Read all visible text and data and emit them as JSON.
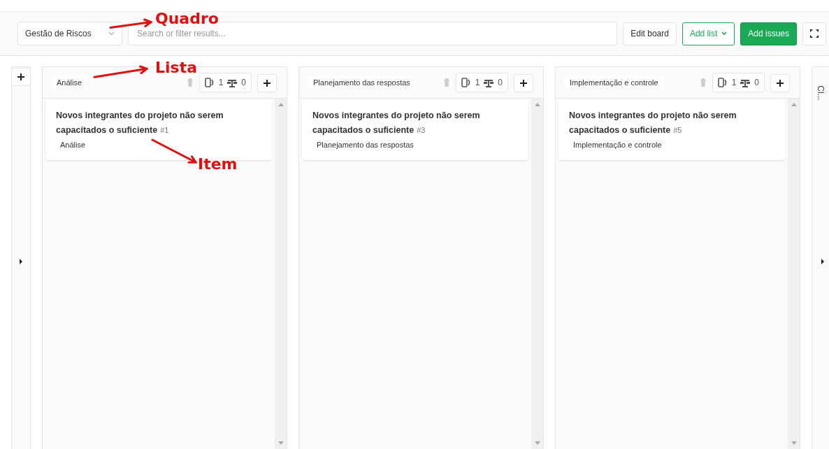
{
  "board_selector": {
    "value": "Gestão de Riscos"
  },
  "search": {
    "placeholder": "Search or filter results..."
  },
  "toolbar_buttons": [
    {
      "kind": "default",
      "label": "Edit board"
    },
    {
      "kind": "outline",
      "label": "Add list"
    },
    {
      "kind": "primary",
      "label": "Add issues"
    },
    {
      "kind": "fullscreen"
    }
  ],
  "lists": [
    {
      "title": "Análise",
      "issue_count": "1",
      "weight": "0",
      "cards": [
        {
          "title": "Novos integrantes do projeto não serem capacitados o suficiente",
          "number": "#1",
          "label": "Análise"
        }
      ]
    },
    {
      "title": "Planejamento das respostas",
      "issue_count": "1",
      "weight": "0",
      "cards": [
        {
          "title": "Novos integrantes do projeto não serem capacitados o suficiente",
          "number": "#3",
          "label": "Planejamento das respostas"
        }
      ]
    },
    {
      "title": "Implementação e controle",
      "issue_count": "1",
      "weight": "0",
      "cards": [
        {
          "title": "Novos integrantes do projeto não serem capacitados o suficiente",
          "number": "#5",
          "label": "Implementação e controle"
        }
      ]
    }
  ],
  "collapsed_list": {
    "title": "Cl..."
  },
  "annotations": [
    {
      "text": "Quadro"
    },
    {
      "text": "Lista"
    },
    {
      "text": "Item"
    }
  ]
}
